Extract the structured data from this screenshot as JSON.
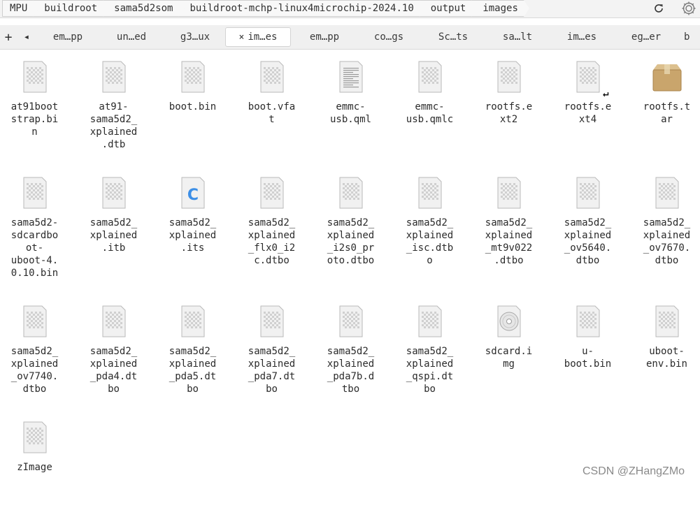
{
  "pathbar": {
    "crumbs": [
      "MPU",
      "buildroot",
      "sama5d2som",
      "buildroot-mchp-linux4microchip-2024.10",
      "output",
      "images"
    ]
  },
  "tabbar": {
    "new_tab_label": "+",
    "prev_label": "◂",
    "tabs": [
      "em…pp",
      "un…ed",
      "g3…ux",
      "im…es",
      "em…pp",
      "co…gs",
      "Sc…ts",
      "sa…lt",
      "im…es",
      "eg…er",
      "b"
    ],
    "active_index": 3,
    "close_glyph": "×"
  },
  "files": [
    {
      "name": "at91boot\nstrap.bi\nn",
      "icon": "generic-file-icon"
    },
    {
      "name": "at91-\nsama5d2_\nxplained\n.dtb",
      "icon": "generic-file-icon"
    },
    {
      "name": "boot.bin",
      "icon": "generic-file-icon"
    },
    {
      "name": "boot.vfa\nt",
      "icon": "generic-file-icon"
    },
    {
      "name": "emmc-\nusb.qml",
      "icon": "text-file-icon"
    },
    {
      "name": "emmc-\nusb.qmlc",
      "icon": "generic-file-icon"
    },
    {
      "name": "rootfs.e\nxt2",
      "icon": "generic-file-icon"
    },
    {
      "name": "rootfs.e\nxt4",
      "icon": "symlink-file-icon"
    },
    {
      "name": "rootfs.t\nar",
      "icon": "archive-icon"
    },
    {
      "name": "sama5d2-\nsdcardbo\not-\nuboot-4.\n0.10.bin",
      "icon": "generic-file-icon"
    },
    {
      "name": "sama5d2_\nxplained\n.itb",
      "icon": "generic-file-icon"
    },
    {
      "name": "sama5d2_\nxplained\n.its",
      "icon": "c-source-icon"
    },
    {
      "name": "sama5d2_\nxplained\n_flx0_i2\nc.dtbo",
      "icon": "generic-file-icon"
    },
    {
      "name": "sama5d2_\nxplained\n_i2s0_pr\noto.dtbo",
      "icon": "generic-file-icon"
    },
    {
      "name": "sama5d2_\nxplained\n_isc.dtb\no",
      "icon": "generic-file-icon"
    },
    {
      "name": "sama5d2_\nxplained\n_mt9v022\n.dtbo",
      "icon": "generic-file-icon"
    },
    {
      "name": "sama5d2_\nxplained\n_ov5640.\ndtbo",
      "icon": "generic-file-icon"
    },
    {
      "name": "sama5d2_\nxplained\n_ov7670.\ndtbo",
      "icon": "generic-file-icon"
    },
    {
      "name": "sama5d2_\nxplained\n_ov7740.\ndtbo",
      "icon": "generic-file-icon"
    },
    {
      "name": "sama5d2_\nxplained\n_pda4.dt\nbo",
      "icon": "generic-file-icon"
    },
    {
      "name": "sama5d2_\nxplained\n_pda5.dt\nbo",
      "icon": "generic-file-icon"
    },
    {
      "name": "sama5d2_\nxplained\n_pda7.dt\nbo",
      "icon": "generic-file-icon"
    },
    {
      "name": "sama5d2_\nxplained\n_pda7b.d\ntbo",
      "icon": "generic-file-icon"
    },
    {
      "name": "sama5d2_\nxplained\n_qspi.dt\nbo",
      "icon": "generic-file-icon"
    },
    {
      "name": "sdcard.i\nmg",
      "icon": "disc-image-icon"
    },
    {
      "name": "u-\nboot.bin",
      "icon": "generic-file-icon"
    },
    {
      "name": "uboot-\nenv.bin",
      "icon": "generic-file-icon"
    },
    {
      "name": "zImage",
      "icon": "generic-file-icon"
    }
  ],
  "watermark": "CSDN @ZHangZMo",
  "colors": {
    "accent": "#3d8fe6",
    "archive": "#c9a56c"
  }
}
